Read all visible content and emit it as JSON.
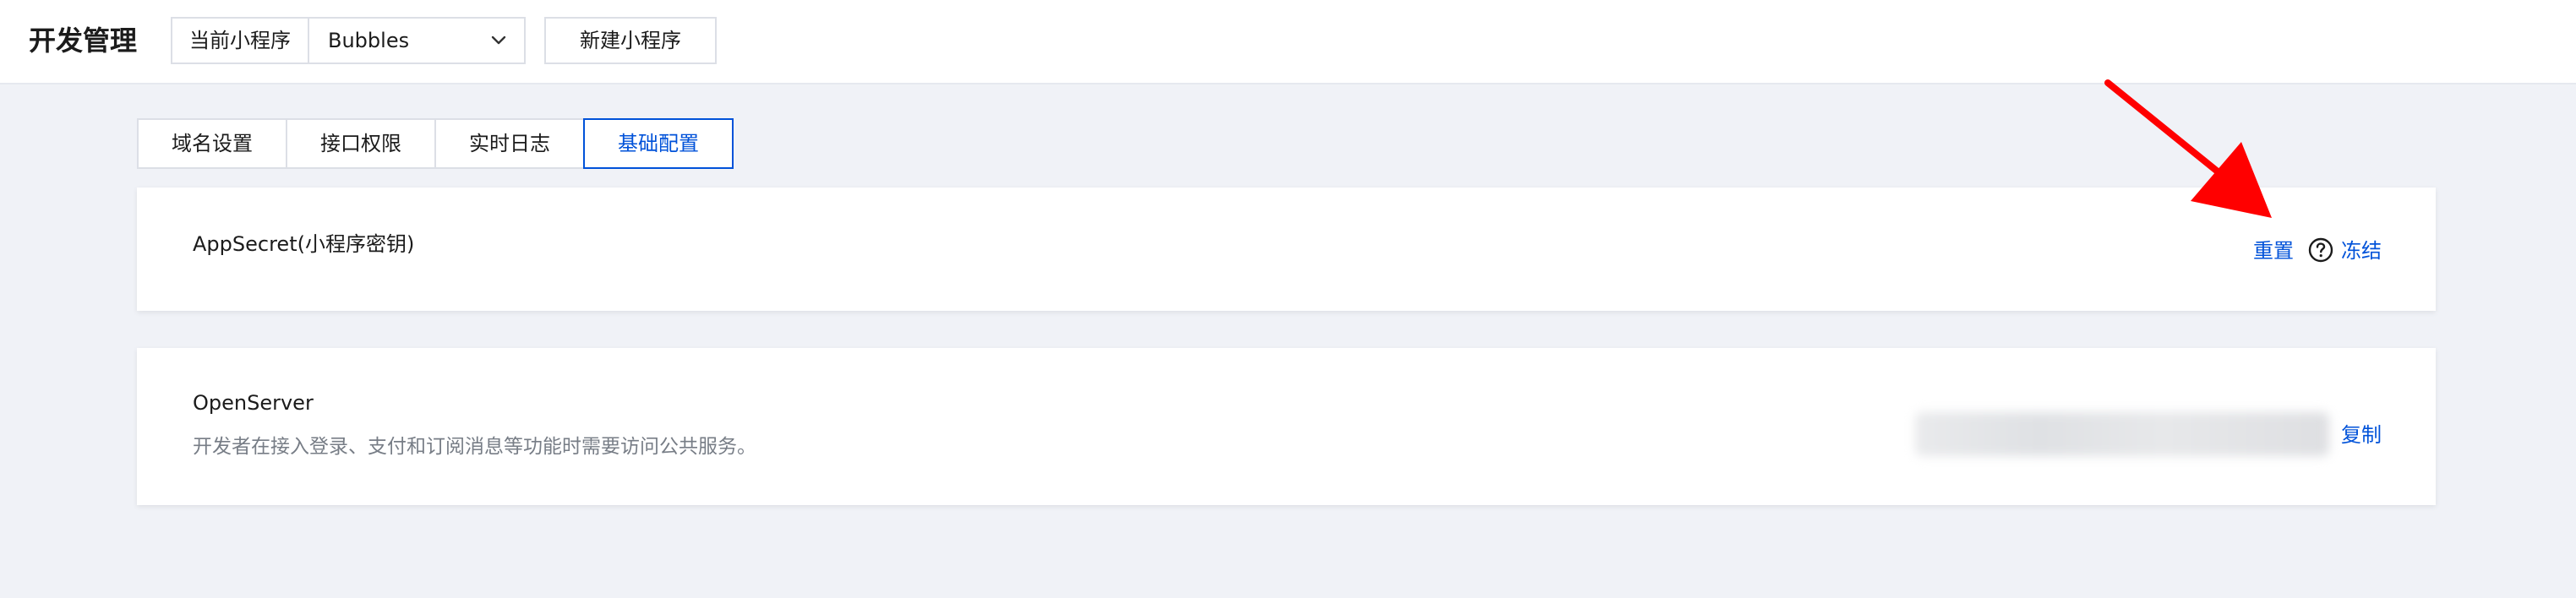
{
  "header": {
    "title": "开发管理",
    "selector_label": "当前小程序",
    "selector_value": "Bubbles",
    "new_button": "新建小程序"
  },
  "tabs": [
    {
      "label": "域名设置",
      "active": false
    },
    {
      "label": "接口权限",
      "active": false
    },
    {
      "label": "实时日志",
      "active": false
    },
    {
      "label": "基础配置",
      "active": true
    }
  ],
  "appsecret_card": {
    "title": "AppSecret(小程序密钥)",
    "reset_link": "重置",
    "freeze_link": "冻结",
    "help_icon": "question-circle-icon"
  },
  "openserver_card": {
    "title": "OpenServer",
    "description": "开发者在接入登录、支付和订阅消息等功能时需要访问公共服务。",
    "copy_link": "复制"
  },
  "colors": {
    "accent": "#0052d9",
    "background": "#f0f2f7",
    "annotation_arrow": "#ff0000"
  }
}
